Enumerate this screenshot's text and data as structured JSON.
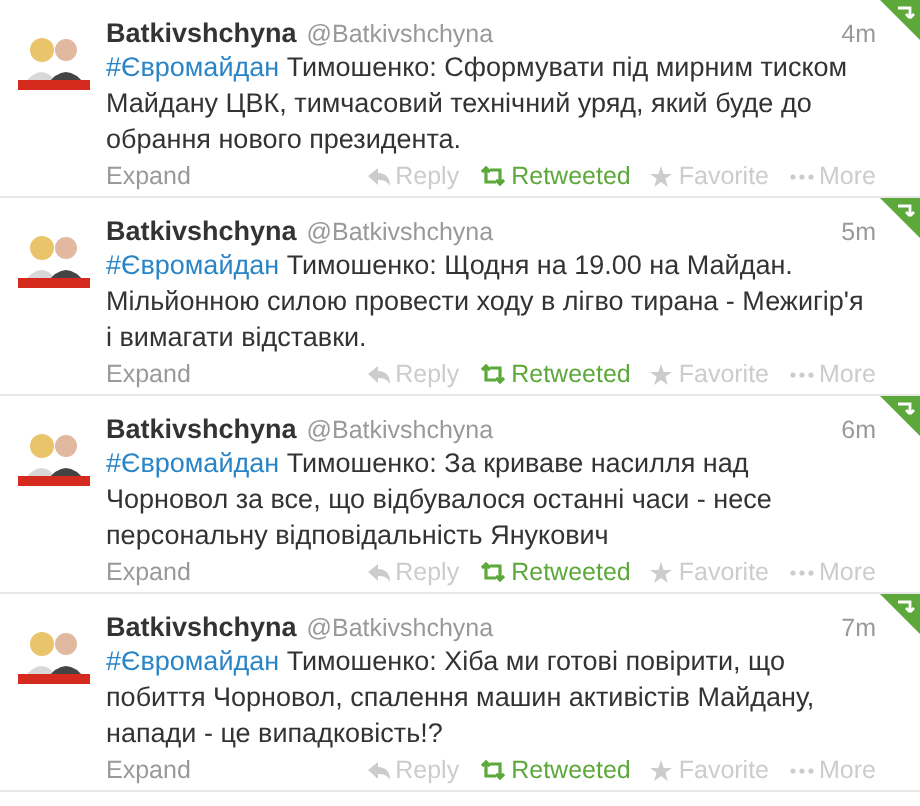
{
  "tweets": [
    {
      "name": "Batkivshchyna",
      "handle": "@Batkivshchyna",
      "time": "4m",
      "hashtag": "#Євромайдан",
      "text": " Тимошенко: Сформувати під мирним тиском Майдану ЦВК, тимчасовий технічний уряд, який буде до обрання нового президента.",
      "expand": "Expand",
      "reply": "Reply",
      "retweet": "Retweeted",
      "retweeted": true,
      "favorite": "Favorite",
      "more": "More"
    },
    {
      "name": "Batkivshchyna",
      "handle": "@Batkivshchyna",
      "time": "5m",
      "hashtag": "#Євромайдан",
      "text": " Тимошенко: Щодня на 19.00 на Майдан. Мільйонною силою провести ходу в лігво тирана - Межигір'я і вимагати відставки.",
      "expand": "Expand",
      "reply": "Reply",
      "retweet": "Retweeted",
      "retweeted": true,
      "favorite": "Favorite",
      "more": "More"
    },
    {
      "name": "Batkivshchyna",
      "handle": "@Batkivshchyna",
      "time": "6m",
      "hashtag": "#Євромайдан",
      "text": " Тимошенко: За криваве насилля над Чорновол за все, що відбувалося останні часи - несе персональну відповідальність Янукович",
      "expand": "Expand",
      "reply": "Reply",
      "retweet": "Retweeted",
      "retweeted": true,
      "favorite": "Favorite",
      "more": "More"
    },
    {
      "name": "Batkivshchyna",
      "handle": "@Batkivshchyna",
      "time": "7m",
      "hashtag": "#Євромайдан",
      "text": " Тимошенко: Хіба ми готові повірити, що побиття Чорновол, спалення машин активістів Майдану, напади - це випадковість!?",
      "expand": "Expand",
      "reply": "Reply",
      "retweet": "Retweeted",
      "retweeted": true,
      "favorite": "Favorite",
      "more": "More"
    }
  ]
}
